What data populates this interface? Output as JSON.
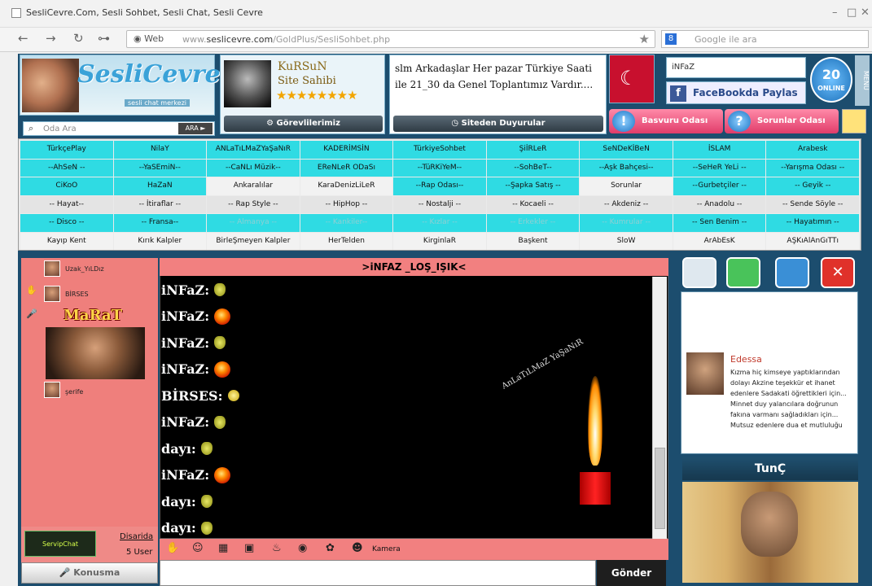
{
  "browser": {
    "window_title": "SesliCevre.Com, Sesli Sohbet, Sesli Chat, Sesli Cevre",
    "url_prefix": "www.",
    "url_domain": "seslicevre.com",
    "url_path": "/GoldPlus/SesliSohbet.php",
    "web_label": "Web",
    "search_placeholder": "Google ile ara",
    "google_badge": "8"
  },
  "header": {
    "logo_text": "SesliCevre",
    "logo_sub": "sesli chat merkezi",
    "search_placeholder": "Oda Ara",
    "search_button": "ARA ►",
    "owner": {
      "name": "KuRSuN",
      "role": "Site Sahibi",
      "stars": "★★★★★★★★",
      "tasks_button": "Görevlilerimiz"
    },
    "announcement": {
      "text": "slm Arkadaşlar Her pazar Türkiye Saati ile 21_30 da Genel Toplantımız Vardır....",
      "button": "Siteden Duyurular"
    },
    "current_user": "iNFaZ",
    "facebook_share": "FaceBookda Paylas",
    "online_count": "20",
    "online_label": "ONLINE",
    "menu_label": "MENU",
    "reception_button": "Basvuru Odası",
    "questions_button": "Sorunlar Odası"
  },
  "rooms": [
    [
      "TürkçePlay",
      "NilaY",
      "ANLaTıLMaZYaŞaNıR",
      "KADERİMSİN",
      "TürkiyeSohbet",
      "ŞiİRLeR",
      "SeNDeKİBeN",
      "İSLAM",
      "Arabesk"
    ],
    [
      "--AhSeN --",
      "--YaSEmiN--",
      "--CaNLı Müzik--",
      "EReNLeR ODaSı",
      "--TüRKiYeM--",
      "--SohBeT--",
      "--Aşk Bahçesi--",
      "--SeHeR YeLi --",
      "--Yarışma Odası --"
    ],
    [
      "CiKoO",
      "HaZaN",
      "Ankaralılar",
      "KaraDenizLiLeR",
      "--Rap Odası--",
      "--Şapka Satış --",
      "Sorunlar",
      "--Gurbetçiler --",
      "-- Geyik --"
    ],
    [
      "-- Hayat--",
      "-- İtiraflar --",
      "-- Rap Style --",
      "-- HipHop --",
      "-- Nostalji --",
      "-- Kocaeli --",
      "-- Akdeniz --",
      "-- Anadolu --",
      "-- Sende Söyle --"
    ],
    [
      "-- Disco --",
      "-- Fransa--",
      "-- Almanya --",
      "-- Kankiler--",
      "-- Kızlar --",
      "-- Erkekler --",
      "-- Kumrular --",
      "-- Sen Benim --",
      "-- Hayatımın --"
    ],
    [
      "Kayıp Kent",
      "Kırık Kalpler",
      "BirleŞmeyen Kalpler",
      "HerTelden",
      "KirginlaR",
      "Başkent",
      "SloW",
      "ArAbEsK",
      "AŞKıAlAnGıTTı"
    ]
  ],
  "left_panel": {
    "users": [
      {
        "name": "Uzak_YıLDız"
      },
      {
        "name": "BİRSES"
      },
      {
        "name": "şerife"
      }
    ],
    "featured_name": "MaRaT",
    "away_label": "Disarida",
    "user_count": "5 User",
    "logo_label": "ServipChat",
    "talk_button": "Konusma"
  },
  "chat": {
    "title": ">iNFAZ _LOŞ_IŞIK<",
    "art_text": "AnLaTıLMaZ YaŞaNıR",
    "camera_label": "Kamera",
    "send_button": "Gönder",
    "messages": [
      {
        "nick": "iNFaZ:",
        "icon": "hand"
      },
      {
        "nick": "iNFaZ:",
        "icon": "fire"
      },
      {
        "nick": "iNFaZ:",
        "icon": "hand"
      },
      {
        "nick": "iNFaZ:",
        "icon": "fire"
      },
      {
        "nick": "BİRSES:",
        "icon": "smile"
      },
      {
        "nick": "iNFaZ:",
        "icon": "hand"
      },
      {
        "nick": "dayı:",
        "icon": "hand"
      },
      {
        "nick": "iNFaZ:",
        "icon": "fire"
      },
      {
        "nick": "dayı:",
        "icon": "hand"
      },
      {
        "nick": "dayı:",
        "icon": "hand"
      }
    ]
  },
  "right_panel": {
    "feed_name": "Edessa",
    "feed_text": "Kızma hiç kimseye yaptıklarından dolayı Akzine teşekkür et ihanet edenlere Sadakati öğrettikleri için... Minnet duy yalancılara doğrunun fakına varmanı sağladıkları için... Mutsuz edenlere dua et mutluluğu",
    "featured_title": "TunÇ"
  }
}
